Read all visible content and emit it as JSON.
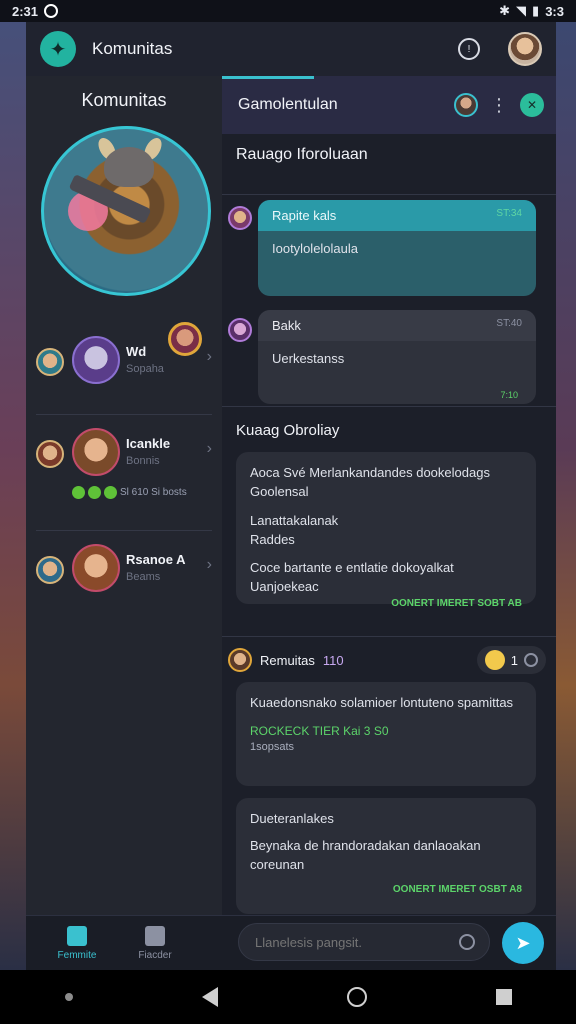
{
  "status": {
    "time": "2:31",
    "battery": "3:3"
  },
  "header": {
    "title": "Komunitas"
  },
  "left": {
    "heading": "Komunitas",
    "friends": [
      {
        "name": "Wd",
        "sub": "Sopaha",
        "extra": ""
      },
      {
        "name": "Icankle",
        "sub": "Bonnis",
        "extra": "Sl 610   Si bosts"
      },
      {
        "name": "Rsanoe  A",
        "sub": "Beams",
        "extra": ""
      }
    ]
  },
  "chat": {
    "tab_title": "Gamolentulan",
    "room_title": "Rauago Iforoluaan",
    "messages": [
      {
        "name": "Rapite kals",
        "time": "ST:34",
        "text": "Iootylolelolaula"
      },
      {
        "name": "Bakk",
        "time": "ST:40",
        "text": "Uerkestanss",
        "meta": "7:10"
      }
    ],
    "section2_title": "Kuaag Obroliay",
    "post": {
      "line1": "Aoca Své Merlankandandes dookelodags Goolensal",
      "line2": "Lanattakalanak",
      "line3": "Raddes",
      "line4": "Coce bartante e entlatie dokoyalkat Uanjoekeac",
      "footer": "OONERT IMERET SOBT AB"
    },
    "community_row": {
      "label": "Remuitas",
      "count": "110",
      "react_count": "1"
    },
    "card2": {
      "text": "Kuaedonsnako solamioer lontuteno spamittas",
      "green": "ROCKECK TIER Kai 3 S0",
      "sub": "1sopsats"
    },
    "card3": {
      "title": "Dueteranlakes",
      "text": "Beynaka de hrandoradakan danlaoakan coreunan",
      "footer": "OONERT IMERET OSBT A8"
    }
  },
  "bottom": {
    "nav": [
      {
        "label": "Femmite"
      },
      {
        "label": "Fiacder"
      }
    ],
    "input_placeholder": "Llanelesis pangsit."
  }
}
